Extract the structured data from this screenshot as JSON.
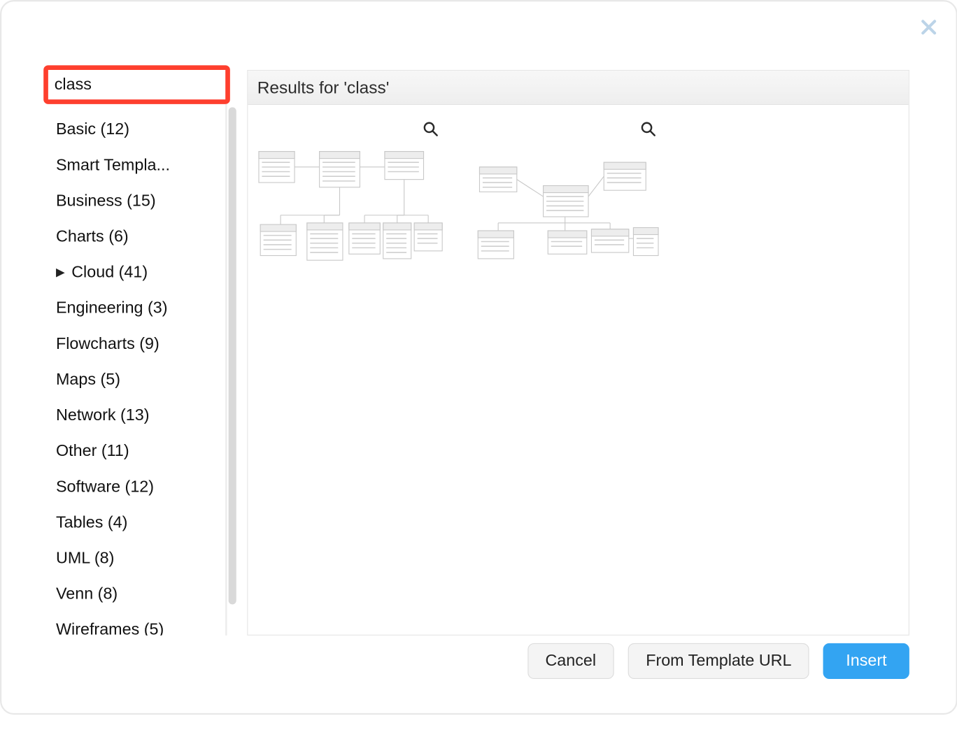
{
  "search": {
    "value": "class"
  },
  "sidebar": {
    "items": [
      {
        "label": "Basic (12)",
        "expandable": false
      },
      {
        "label": "Smart Templa...",
        "expandable": false
      },
      {
        "label": "Business (15)",
        "expandable": false
      },
      {
        "label": "Charts (6)",
        "expandable": false
      },
      {
        "label": "Cloud (41)",
        "expandable": true
      },
      {
        "label": "Engineering (3)",
        "expandable": false
      },
      {
        "label": "Flowcharts (9)",
        "expandable": false
      },
      {
        "label": "Maps (5)",
        "expandable": false
      },
      {
        "label": "Network (13)",
        "expandable": false
      },
      {
        "label": "Other (11)",
        "expandable": false
      },
      {
        "label": "Software (12)",
        "expandable": false
      },
      {
        "label": "Tables (4)",
        "expandable": false
      },
      {
        "label": "UML (8)",
        "expandable": false
      },
      {
        "label": "Venn (8)",
        "expandable": false
      },
      {
        "label": "Wireframes (5)",
        "expandable": false
      }
    ]
  },
  "results": {
    "header": "Results for 'class'",
    "thumbs": [
      {
        "name": "template-result-1"
      },
      {
        "name": "template-result-2"
      }
    ]
  },
  "footer": {
    "cancel": "Cancel",
    "from_url": "From Template URL",
    "insert": "Insert"
  },
  "colors": {
    "highlight": "#FE3F2E",
    "primary": "#33a4f2"
  }
}
